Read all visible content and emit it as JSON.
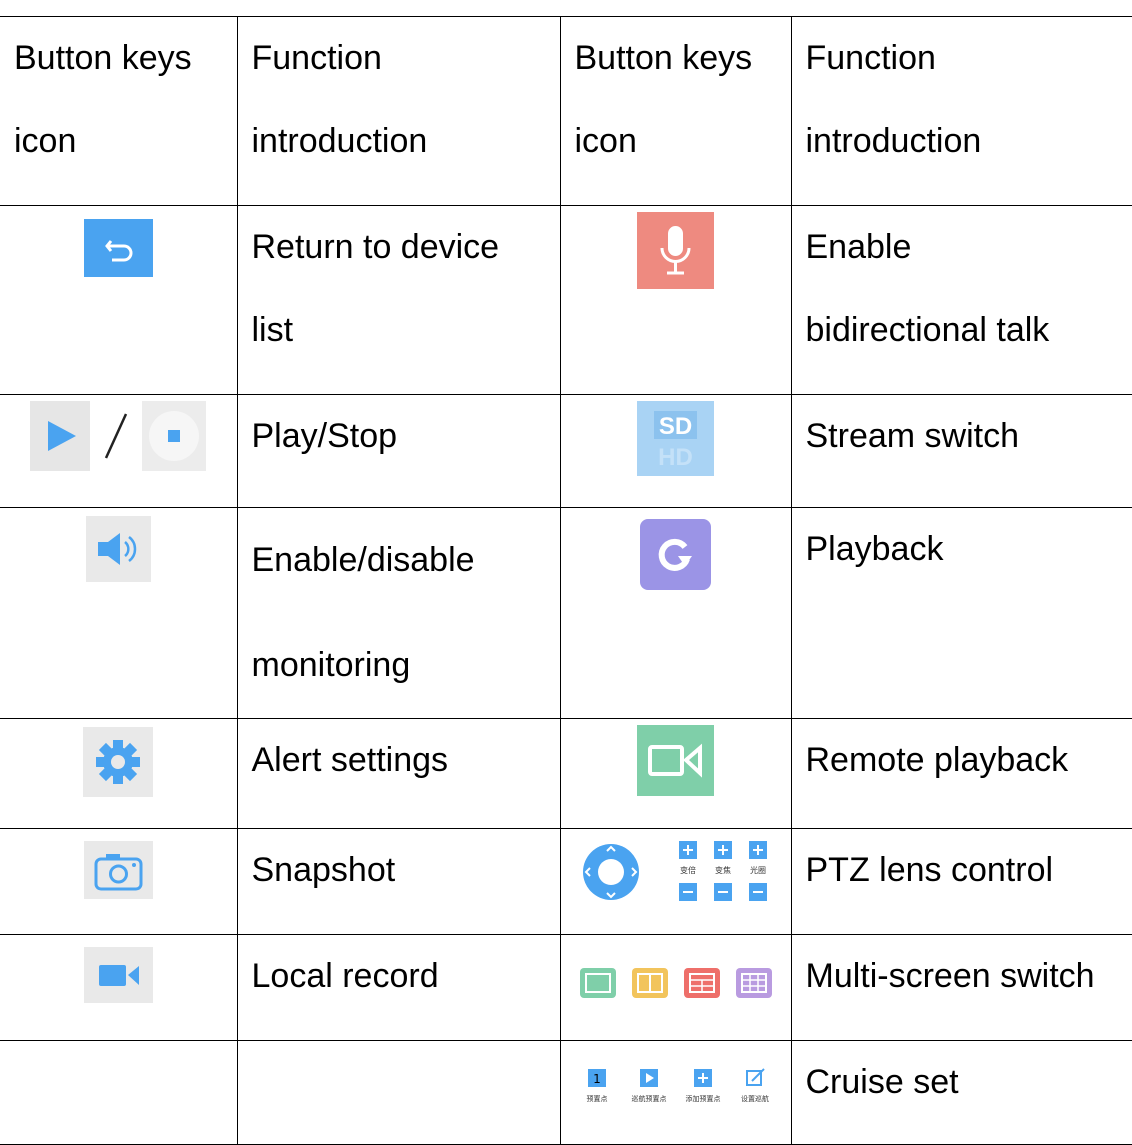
{
  "header": {
    "col1": [
      "Button keys",
      "icon"
    ],
    "col2": [
      "Function",
      "introduction"
    ],
    "col3": [
      "Button keys",
      "icon"
    ],
    "col4": [
      "Function",
      "introduction"
    ]
  },
  "rows": [
    {
      "left_icon": "return-icon",
      "left_text": [
        "Return to device",
        "list"
      ],
      "right_icon": "microphone-icon",
      "right_text": [
        "Enable",
        "bidirectional talk"
      ]
    },
    {
      "left_icon": "play-stop-icon",
      "left_text": [
        "Play/Stop"
      ],
      "right_icon": "sd-hd-icon",
      "right_text": [
        "Stream switch"
      ]
    },
    {
      "left_icon": "speaker-icon",
      "left_text": [
        "Enable/disable",
        "monitoring"
      ],
      "right_icon": "playback-icon",
      "right_text": [
        "Playback"
      ]
    },
    {
      "left_icon": "gear-icon",
      "left_text": [
        "Alert settings"
      ],
      "right_icon": "video-camera-icon",
      "right_text": [
        "Remote playback"
      ]
    },
    {
      "left_icon": "camera-icon",
      "left_text": [
        "Snapshot"
      ],
      "right_icon": "ptz-control-icon",
      "right_text": [
        "PTZ lens control"
      ]
    },
    {
      "left_icon": "record-icon",
      "left_text": [
        "Local record"
      ],
      "right_icon": "multi-screen-icons",
      "right_text": [
        "Multi-screen switch"
      ]
    },
    {
      "left_icon": "",
      "left_text": [
        ""
      ],
      "right_icon": "cruise-set-icons",
      "right_text": [
        "Cruise set"
      ]
    }
  ],
  "icon_labels": {
    "sd": "SD",
    "hd": "HD",
    "ptz": [
      "变倍",
      "变焦",
      "光圈"
    ],
    "cruise": [
      "1",
      "预置点",
      "巡航预置点",
      "添加预置点",
      "设置巡航"
    ]
  },
  "colors": {
    "blue": "#4aa3f0",
    "mic_red": "#ee8a80",
    "sdhd": "#a9d3f4",
    "purple": "#9b94e6",
    "green": "#7fcfa9",
    "icon_bg": "#e9e9e9"
  }
}
